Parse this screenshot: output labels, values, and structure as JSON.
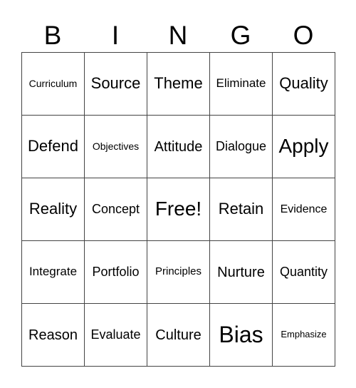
{
  "header": [
    "B",
    "I",
    "N",
    "G",
    "O"
  ],
  "rows": [
    [
      "Curriculum",
      "Source",
      "Theme",
      "Eliminate",
      "Quality"
    ],
    [
      "Defend",
      "Objectives",
      "Attitude",
      "Dialogue",
      "Apply"
    ],
    [
      "Reality",
      "Concept",
      "Free!",
      "Retain",
      "Evidence"
    ],
    [
      "Integrate",
      "Portfolio",
      "Principles",
      "Nurture",
      "Quantity"
    ],
    [
      "Reason",
      "Evaluate",
      "Culture",
      "Bias",
      "Emphasize"
    ]
  ]
}
